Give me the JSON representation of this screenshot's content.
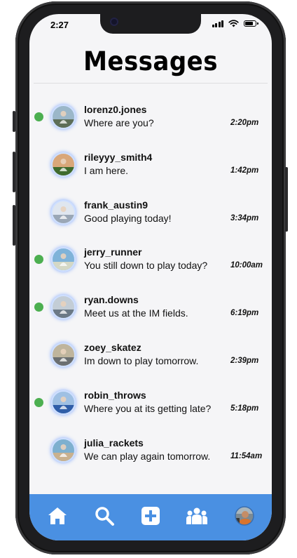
{
  "status_bar": {
    "time": "2:27"
  },
  "header": {
    "title": "Messages"
  },
  "conversations": [
    {
      "username": "lorenz0.jones",
      "message": "Where are you?",
      "time": "2:20pm",
      "unread": true,
      "avatar_colors": [
        "#9bb7c9",
        "#5d6e58"
      ]
    },
    {
      "username": "rileyyy_smith4",
      "message": "I am here.",
      "time": "1:42pm",
      "unread": false,
      "avatar_colors": [
        "#d9a77a",
        "#3f6b2e"
      ]
    },
    {
      "username": "frank_austin9",
      "message": "Good playing today!",
      "time": "3:34pm",
      "unread": false,
      "avatar_colors": [
        "#dfe6ef",
        "#9aa7b6"
      ]
    },
    {
      "username": "jerry_runner",
      "message": "You still down to play today?",
      "time": "10:00am",
      "unread": true,
      "avatar_colors": [
        "#7fb3d9",
        "#d4d8c6"
      ]
    },
    {
      "username": "ryan.downs",
      "message": "Meet us at the IM fields.",
      "time": "6:19pm",
      "unread": true,
      "avatar_colors": [
        "#c3cdd6",
        "#6b7986"
      ]
    },
    {
      "username": "zoey_skatez",
      "message": "Im down to play tomorrow.",
      "time": "2:39pm",
      "unread": false,
      "avatar_colors": [
        "#bfb59d",
        "#6b6f71"
      ]
    },
    {
      "username": "robin_throws",
      "message": "Where you at its getting late?",
      "time": "5:18pm",
      "unread": true,
      "avatar_colors": [
        "#9fc0e3",
        "#2f5ea8"
      ]
    },
    {
      "username": "julia_rackets",
      "message": "We can play again tomorrow.",
      "time": "11:54am",
      "unread": false,
      "avatar_colors": [
        "#7eb0cf",
        "#c9b18f"
      ]
    }
  ],
  "nav": {
    "background": "#4a90e2",
    "items": [
      "home-icon",
      "search-icon",
      "plus-square-icon",
      "group-icon",
      "profile-avatar"
    ]
  },
  "colors": {
    "unread_dot": "#4caf50",
    "avatar_glow": "#7fa8ff"
  }
}
